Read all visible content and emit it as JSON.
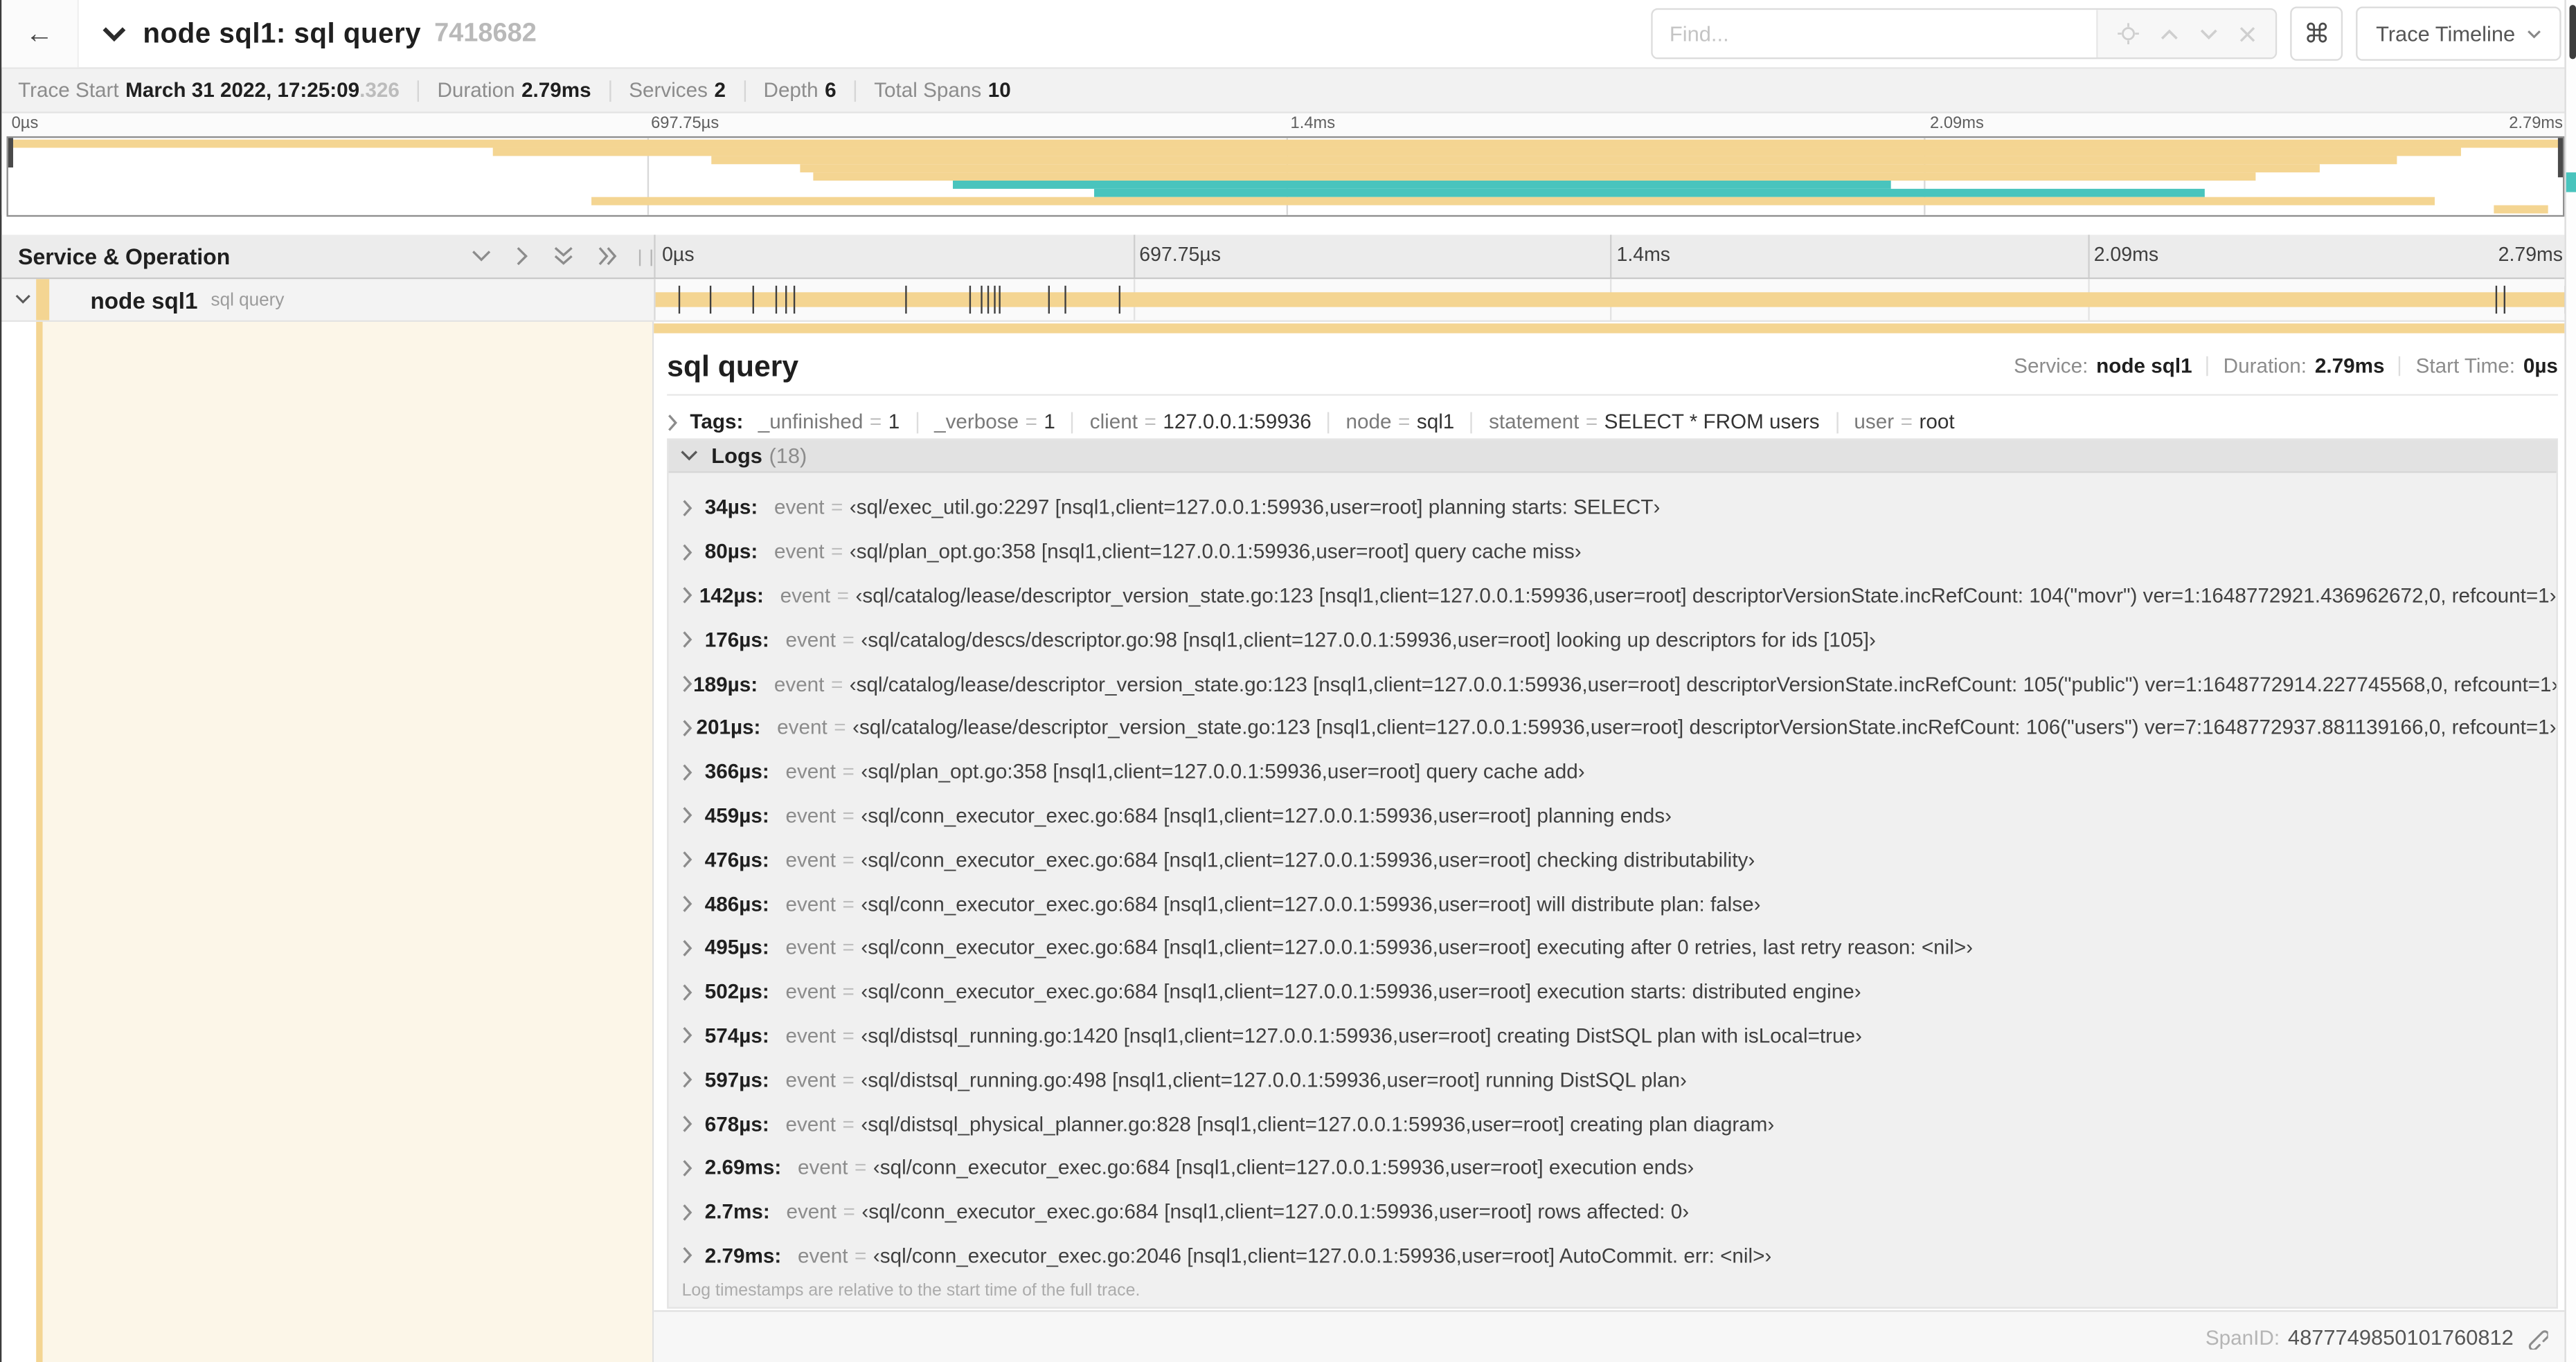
{
  "header": {
    "back_arrow": "←",
    "title": "node sql1: sql query",
    "trace_id": "7418682",
    "find_placeholder": "Find...",
    "shortcut_glyph": "⌘",
    "view_button": "Trace Timeline"
  },
  "stats": [
    {
      "label": "Trace Start",
      "value": "March 31 2022, 17:25:09",
      "suffix": ".326"
    },
    {
      "label": "Duration",
      "value": "2.79ms"
    },
    {
      "label": "Services",
      "value": "2"
    },
    {
      "label": "Depth",
      "value": "6"
    },
    {
      "label": "Total Spans",
      "value": "10"
    }
  ],
  "timeline": {
    "total_us": 2790,
    "ticks": [
      {
        "label": "0µs",
        "pos": 0
      },
      {
        "label": "697.75µs",
        "pos": 25
      },
      {
        "label": "1.4ms",
        "pos": 50
      },
      {
        "label": "2.09ms",
        "pos": 75
      },
      {
        "label": "2.79ms",
        "pos": 100
      }
    ],
    "gridlines": [
      25,
      50,
      75
    ],
    "minimap_spans": [
      {
        "r": 0,
        "s": 0,
        "e": 100,
        "c": "tan"
      },
      {
        "r": 1,
        "s": 19,
        "e": 96,
        "c": "tan"
      },
      {
        "r": 2,
        "s": 27.5,
        "e": 93.5,
        "c": "tan"
      },
      {
        "r": 3,
        "s": 31,
        "e": 90.5,
        "c": "tan"
      },
      {
        "r": 4,
        "s": 31.5,
        "e": 88,
        "c": "tan"
      },
      {
        "r": 5,
        "s": 37,
        "e": 73.7,
        "c": "teal"
      },
      {
        "r": 6,
        "s": 42.5,
        "e": 86,
        "c": "teal"
      },
      {
        "r": 7,
        "s": 22.8,
        "e": 95,
        "c": "tan"
      },
      {
        "r": 8,
        "s": 97.3,
        "e": 99.4,
        "c": "tan"
      }
    ]
  },
  "left_header": {
    "label": "Service & Operation"
  },
  "span_row": {
    "service": "node sql1",
    "operation": "sql query"
  },
  "detail": {
    "title": "sql query",
    "meta": [
      {
        "label": "Service:",
        "value": "node sql1"
      },
      {
        "label": "Duration:",
        "value": "2.79ms"
      },
      {
        "label": "Start Time:",
        "value": "0µs"
      }
    ],
    "tags": {
      "label": "Tags:",
      "items": [
        {
          "k": "_unfinished",
          "v": "1"
        },
        {
          "k": "_verbose",
          "v": "1"
        },
        {
          "k": "client",
          "v": "127.0.0.1:59936"
        },
        {
          "k": "node",
          "v": "sql1"
        },
        {
          "k": "statement",
          "v": "SELECT * FROM users"
        },
        {
          "k": "user",
          "v": "root"
        }
      ]
    }
  },
  "logs": {
    "label": "Logs",
    "count": "(18)",
    "key": "event",
    "footer": "Log timestamps are relative to the start time of the full trace.",
    "entries": [
      {
        "t": "34µs:",
        "us": 34,
        "text": "‹sql/exec_util.go:2297 [nsql1,client=127.0.0.1:59936,user=root] planning starts: SELECT›"
      },
      {
        "t": "80µs:",
        "us": 80,
        "text": "‹sql/plan_opt.go:358 [nsql1,client=127.0.0.1:59936,user=root] query cache miss›"
      },
      {
        "t": "142µs:",
        "us": 142,
        "text": "‹sql/catalog/lease/descriptor_version_state.go:123 [nsql1,client=127.0.0.1:59936,user=root] descriptorVersionState.incRefCount: 104(\"movr\") ver=1:1648772921.436962672,0, refcount=1›"
      },
      {
        "t": "176µs:",
        "us": 176,
        "text": "‹sql/catalog/descs/descriptor.go:98 [nsql1,client=127.0.0.1:59936,user=root] looking up descriptors for ids [105]›"
      },
      {
        "t": "189µs:",
        "us": 189,
        "text": "‹sql/catalog/lease/descriptor_version_state.go:123 [nsql1,client=127.0.0.1:59936,user=root] descriptorVersionState.incRefCount: 105(\"public\") ver=1:1648772914.227745568,0, refcount=1›"
      },
      {
        "t": "201µs:",
        "us": 201,
        "text": "‹sql/catalog/lease/descriptor_version_state.go:123 [nsql1,client=127.0.0.1:59936,user=root] descriptorVersionState.incRefCount: 106(\"users\") ver=7:1648772937.881139166,0, refcount=1›"
      },
      {
        "t": "366µs:",
        "us": 366,
        "text": "‹sql/plan_opt.go:358 [nsql1,client=127.0.0.1:59936,user=root] query cache add›"
      },
      {
        "t": "459µs:",
        "us": 459,
        "text": "‹sql/conn_executor_exec.go:684 [nsql1,client=127.0.0.1:59936,user=root] planning ends›"
      },
      {
        "t": "476µs:",
        "us": 476,
        "text": "‹sql/conn_executor_exec.go:684 [nsql1,client=127.0.0.1:59936,user=root] checking distributability›"
      },
      {
        "t": "486µs:",
        "us": 486,
        "text": "‹sql/conn_executor_exec.go:684 [nsql1,client=127.0.0.1:59936,user=root] will distribute plan: false›"
      },
      {
        "t": "495µs:",
        "us": 495,
        "text": "‹sql/conn_executor_exec.go:684 [nsql1,client=127.0.0.1:59936,user=root] executing after 0 retries, last retry reason: <nil>›"
      },
      {
        "t": "502µs:",
        "us": 502,
        "text": "‹sql/conn_executor_exec.go:684 [nsql1,client=127.0.0.1:59936,user=root] execution starts: distributed engine›"
      },
      {
        "t": "574µs:",
        "us": 574,
        "text": "‹sql/distsql_running.go:1420 [nsql1,client=127.0.0.1:59936,user=root] creating DistSQL plan with isLocal=true›"
      },
      {
        "t": "597µs:",
        "us": 597,
        "text": "‹sql/distsql_running.go:498 [nsql1,client=127.0.0.1:59936,user=root] running DistSQL plan›"
      },
      {
        "t": "678µs:",
        "us": 678,
        "text": "‹sql/distsql_physical_planner.go:828 [nsql1,client=127.0.0.1:59936,user=root] creating plan diagram›"
      },
      {
        "t": "2.69ms:",
        "us": 2690,
        "text": "‹sql/conn_executor_exec.go:684 [nsql1,client=127.0.0.1:59936,user=root] execution ends›"
      },
      {
        "t": "2.7ms:",
        "us": 2700,
        "text": "‹sql/conn_executor_exec.go:684 [nsql1,client=127.0.0.1:59936,user=root] rows affected: 0›"
      },
      {
        "t": "2.79ms:",
        "us": 2790,
        "text": "‹sql/conn_executor_exec.go:2046 [nsql1,client=127.0.0.1:59936,user=root] AutoCommit. err: <nil>›"
      }
    ]
  },
  "footer": {
    "spanid_label": "SpanID:",
    "spanid_value": "4877749850101760812"
  },
  "colors": {
    "span_tan": "#f4d592",
    "span_teal": "#49c4bd",
    "expanded_bg": "#fcf6e8"
  }
}
